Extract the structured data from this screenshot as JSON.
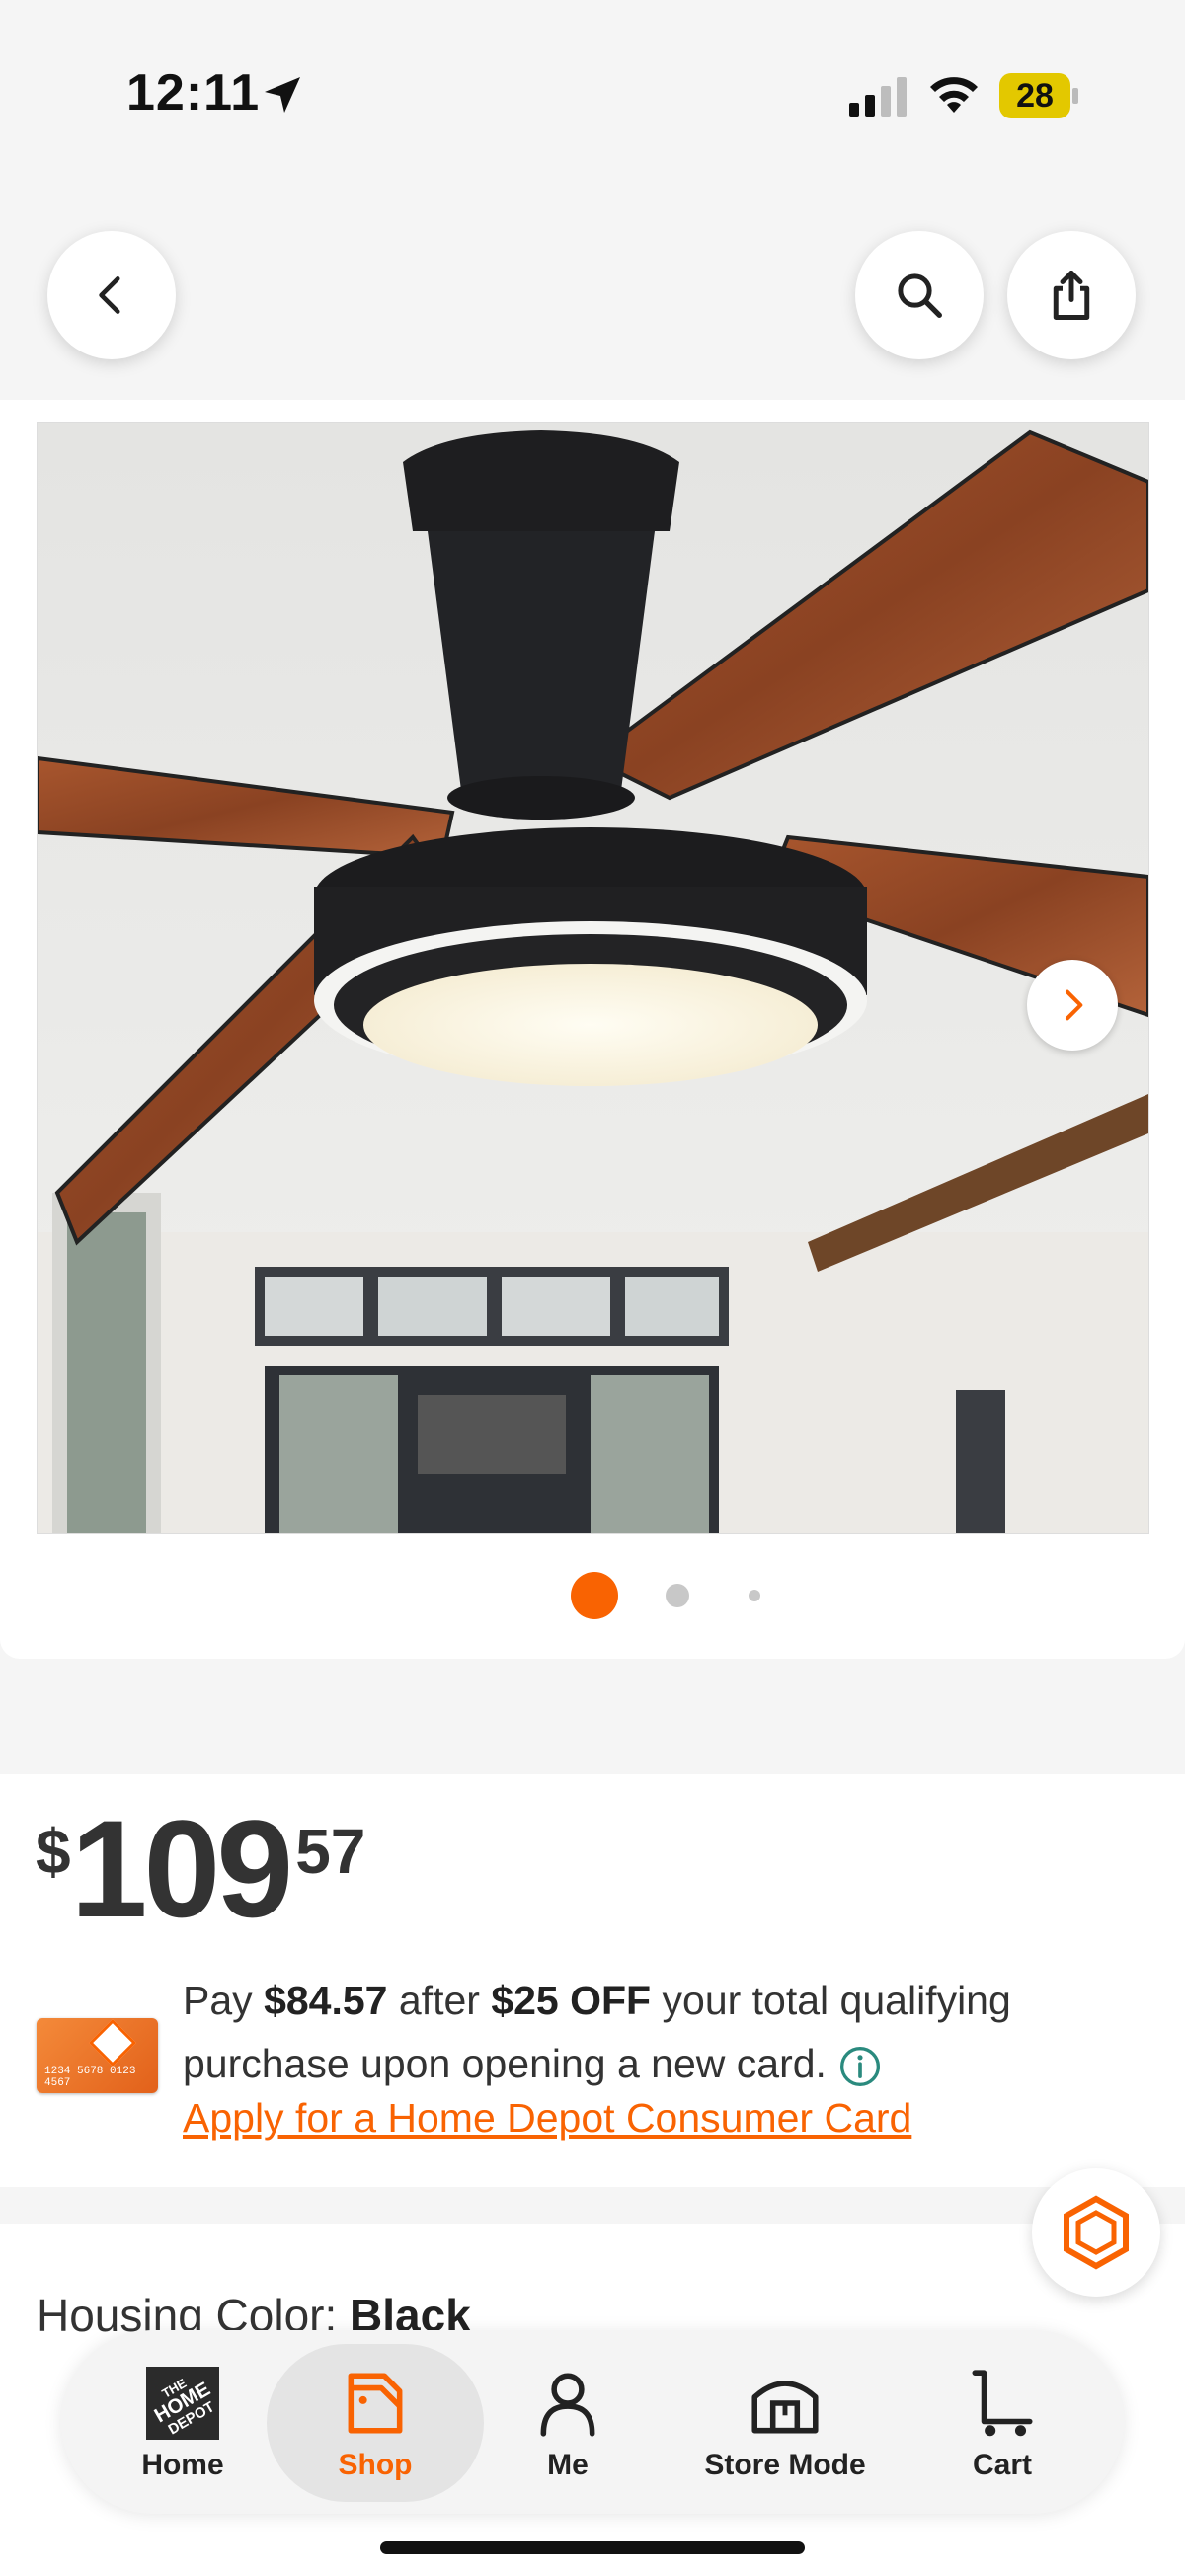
{
  "status_bar": {
    "time": "12:11",
    "battery": "28"
  },
  "nav": {
    "back_icon": "chevron-left-icon",
    "search_icon": "search-icon",
    "share_icon": "share-icon"
  },
  "gallery": {
    "image_alt": "Black flush mount ceiling fan with wood-grain blades and LED light",
    "total_images": 3,
    "active_index": 1
  },
  "price": {
    "currency": "$",
    "dollars": "109",
    "cents": "57"
  },
  "promo": {
    "pay_text": "Pay",
    "pay_amount": "$84.57",
    "after_text": "after",
    "off_amount": "$25 OFF",
    "rest_text": "your total qualifying purchase upon opening a new card.",
    "apply_link": "Apply for a Home Depot Consumer Card",
    "card_number": "1234 5678 0123 4567"
  },
  "housing": {
    "label": "Housing Color:",
    "value": "Black"
  },
  "tabs": [
    {
      "label": "Home",
      "icon": "home-depot-logo-icon"
    },
    {
      "label": "Shop",
      "icon": "shop-tag-icon",
      "active": true
    },
    {
      "label": "Me",
      "icon": "person-icon"
    },
    {
      "label": "Store Mode",
      "icon": "store-icon"
    },
    {
      "label": "Cart",
      "icon": "cart-icon"
    }
  ],
  "colors": {
    "accent": "#f96302",
    "text": "#222222",
    "background": "#f5f5f5"
  }
}
